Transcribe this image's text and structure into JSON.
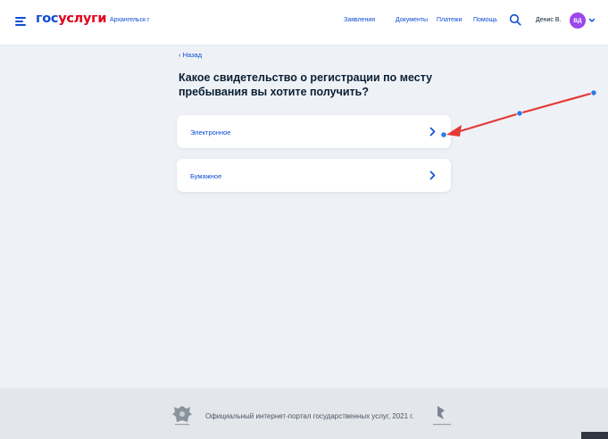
{
  "header": {
    "logo_part1": "гос",
    "logo_part2": "услуги",
    "city": "Архангельск г",
    "nav": [
      "Заявления",
      "Документы",
      "Платежи",
      "Помощь"
    ],
    "user_name": "Денис В.",
    "avatar_initials": "ВД"
  },
  "main": {
    "back_label": "Назад",
    "title": "Какое свидетельство о регистрации по месту пребывания вы хотите получить?",
    "options": [
      {
        "label": "Электронное"
      },
      {
        "label": "Бумажное"
      }
    ]
  },
  "footer": {
    "text": "Официальный интернет-портал государственных услуг, 2021 г."
  },
  "colors": {
    "accent": "#0d4cd3",
    "brand_red": "#e1001b",
    "annotation_arrow": "#e53935",
    "annotation_dot": "#2f7bea",
    "avatar": "#9b47ec"
  },
  "icons": [
    "menu-icon",
    "search-icon",
    "chevron-down-icon",
    "chevron-left-icon",
    "chevron-right-icon",
    "coat-of-arms-icon",
    "rostelecom-logo-icon"
  ]
}
